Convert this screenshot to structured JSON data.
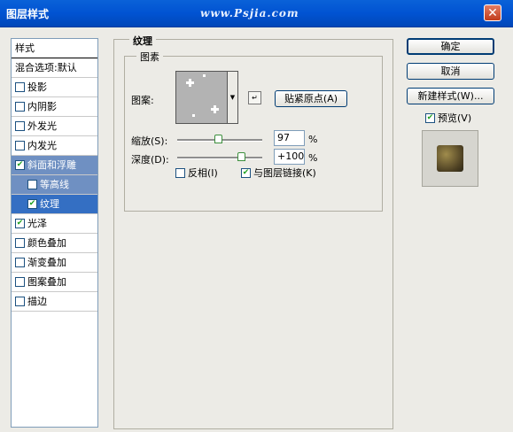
{
  "window": {
    "title": "图层样式",
    "watermark": "www.Psjia.com",
    "close_symbol": "✕"
  },
  "styles_list": {
    "header": "样式",
    "items": [
      {
        "label": "混合选项:默认",
        "has_checkbox": false,
        "checked": false,
        "state": "normal",
        "sub": false
      },
      {
        "label": "投影",
        "has_checkbox": true,
        "checked": false,
        "state": "normal",
        "sub": false
      },
      {
        "label": "内阴影",
        "has_checkbox": true,
        "checked": false,
        "state": "normal",
        "sub": false
      },
      {
        "label": "外发光",
        "has_checkbox": true,
        "checked": false,
        "state": "normal",
        "sub": false
      },
      {
        "label": "内发光",
        "has_checkbox": true,
        "checked": false,
        "state": "normal",
        "sub": false
      },
      {
        "label": "斜面和浮雕",
        "has_checkbox": true,
        "checked": true,
        "state": "highlighted",
        "sub": false
      },
      {
        "label": "等高线",
        "has_checkbox": true,
        "checked": false,
        "state": "highlighted",
        "sub": true
      },
      {
        "label": "纹理",
        "has_checkbox": true,
        "checked": true,
        "state": "selected",
        "sub": true
      },
      {
        "label": "光泽",
        "has_checkbox": true,
        "checked": true,
        "state": "normal",
        "sub": false
      },
      {
        "label": "颜色叠加",
        "has_checkbox": true,
        "checked": false,
        "state": "normal",
        "sub": false
      },
      {
        "label": "渐变叠加",
        "has_checkbox": true,
        "checked": false,
        "state": "normal",
        "sub": false
      },
      {
        "label": "图案叠加",
        "has_checkbox": true,
        "checked": false,
        "state": "normal",
        "sub": false
      },
      {
        "label": "描边",
        "has_checkbox": true,
        "checked": false,
        "state": "normal",
        "sub": false
      }
    ]
  },
  "texture": {
    "group_title": "纹理",
    "elements_title": "图素",
    "pattern_label": "图案:",
    "snap_origin_label": "贴紧原点(A)",
    "scale_label": "缩放(S):",
    "scale_value": "97",
    "scale_fraction": 0.48,
    "depth_label": "深度(D):",
    "depth_value": "+100",
    "depth_fraction": 0.75,
    "unit": "%",
    "invert_label": "反相(I)",
    "invert_checked": false,
    "link_label": "与图层链接(K)",
    "link_checked": true
  },
  "buttons": {
    "ok": "确定",
    "cancel": "取消",
    "new_style": "新建样式(W)..."
  },
  "preview": {
    "label": "预览(V)",
    "checked": true
  },
  "colors": {
    "titlebar": "#0153d2",
    "selected": "#346fc3",
    "highlight": "#6f90c2",
    "check": "#21a121"
  }
}
